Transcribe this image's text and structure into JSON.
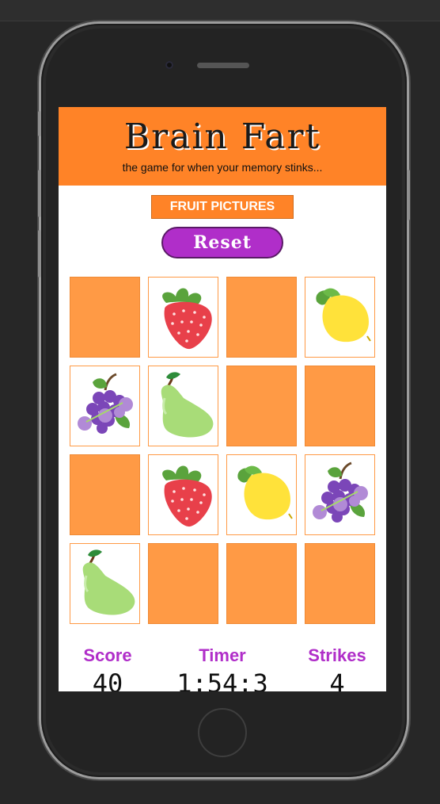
{
  "app": {
    "title": "Brain Fart",
    "subtitle": "the game for when your memory stinks..."
  },
  "controls": {
    "mode_label": "FRUIT PICTURES",
    "reset_label": "Reset"
  },
  "board": {
    "rows": 4,
    "cols": 4,
    "cards": [
      {
        "face": "down",
        "icon": ""
      },
      {
        "face": "up",
        "icon": "strawberry-icon"
      },
      {
        "face": "down",
        "icon": ""
      },
      {
        "face": "up",
        "icon": "lemon-icon"
      },
      {
        "face": "up",
        "icon": "grapes-icon"
      },
      {
        "face": "up",
        "icon": "pear-icon"
      },
      {
        "face": "down",
        "icon": ""
      },
      {
        "face": "down",
        "icon": ""
      },
      {
        "face": "down",
        "icon": ""
      },
      {
        "face": "up",
        "icon": "strawberry-icon"
      },
      {
        "face": "up",
        "icon": "lemon-icon"
      },
      {
        "face": "up",
        "icon": "grapes-icon"
      },
      {
        "face": "up",
        "icon": "pear-icon"
      },
      {
        "face": "down",
        "icon": ""
      },
      {
        "face": "down",
        "icon": ""
      },
      {
        "face": "down",
        "icon": ""
      }
    ]
  },
  "stats": {
    "score_label": "Score",
    "score_value": "40",
    "timer_label": "Timer",
    "timer_value": "1:54:3",
    "strikes_label": "Strikes",
    "strikes_value": "4"
  },
  "colors": {
    "accent_orange": "#ff8327",
    "card_back": "#ff9a45",
    "accent_purple": "#b02ec9"
  }
}
